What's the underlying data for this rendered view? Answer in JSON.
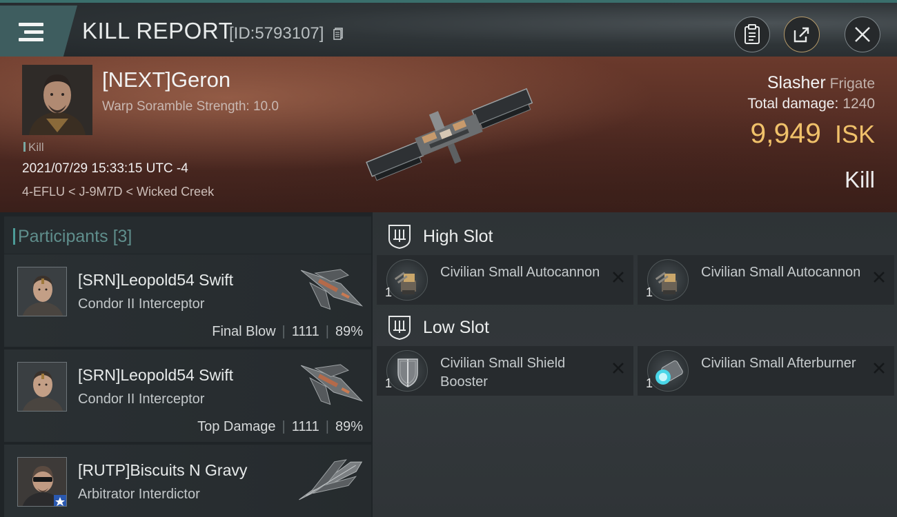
{
  "header": {
    "title": "KILL REPORT",
    "report_id": "[ID:5793107]",
    "icons": [
      "menu-icon",
      "copy-icon",
      "clipboard-icon",
      "share-icon",
      "close-icon"
    ]
  },
  "victim": {
    "name": "[NEXT]Geron",
    "warp": "Warp Soramble Strength: 10.0",
    "tag": "Kill",
    "date": "2021/07/29 15:33:15 UTC -4",
    "location": "4-EFLU < J-9M7D < Wicked Creek",
    "ship": "Slasher",
    "ship_class": "Frigate",
    "total_damage_label": "Total damage:",
    "total_damage": "1240",
    "isk_value": "9,949",
    "isk_unit": "ISK",
    "result": "Kill"
  },
  "participants": {
    "title": "Participants",
    "count": "[3]",
    "items": [
      {
        "name": "[SRN]Leopold54 Swift",
        "ship": "Condor II Interceptor",
        "role": "Final Blow",
        "damage": "1111",
        "percent": "89%"
      },
      {
        "name": "[SRN]Leopold54 Swift",
        "ship": "Condor II Interceptor",
        "role": "Top Damage",
        "damage": "1111",
        "percent": "89%"
      },
      {
        "name": "[RUTP]Biscuits N Gravy",
        "ship": "Arbitrator Interdictor"
      }
    ]
  },
  "fitting": {
    "high_slot": {
      "title": "High Slot",
      "modules": [
        {
          "name": "Civilian Small Autocannon",
          "qty": "1"
        },
        {
          "name": "Civilian Small Autocannon",
          "qty": "1"
        }
      ]
    },
    "low_slot": {
      "title": "Low Slot",
      "modules": [
        {
          "name": "Civilian Small Shield Booster",
          "qty": "1"
        },
        {
          "name": "Civilian Small Afterburner",
          "qty": "1"
        }
      ]
    }
  },
  "colors": {
    "accent": "#4c9c98",
    "isk": "#f0c16a"
  }
}
